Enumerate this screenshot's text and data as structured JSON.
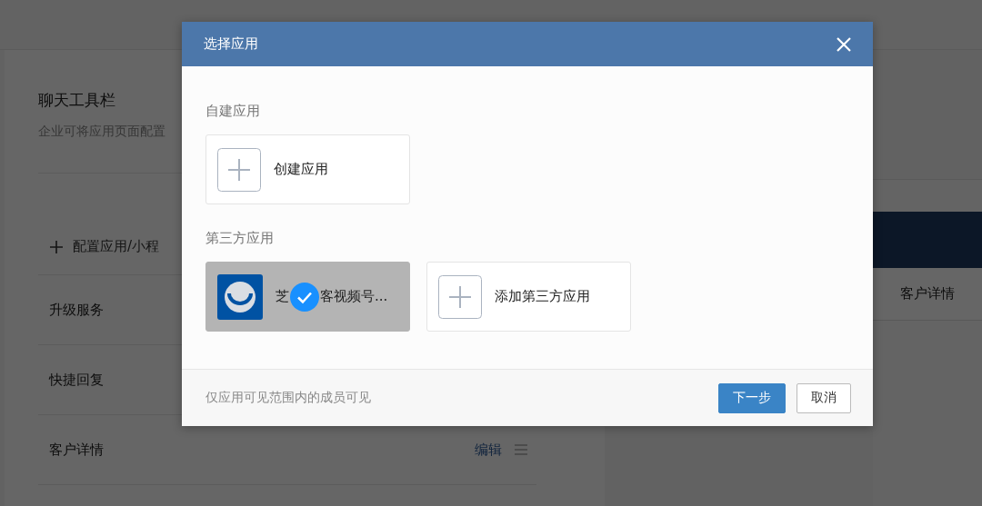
{
  "page": {
    "title": "聊天工具栏",
    "subtitle": "企业可将应用页面配置",
    "add_link": "配置应用/小程",
    "rows": [
      {
        "label": "升级服务"
      },
      {
        "label": "快捷回复"
      },
      {
        "label": "客户详情",
        "action": "编辑"
      }
    ],
    "preview": {
      "label": "客户详情"
    }
  },
  "dialog": {
    "title": "选择应用",
    "sections": [
      {
        "heading": "自建应用",
        "cards": [
          {
            "kind": "add",
            "label": "创建应用",
            "selected": false
          }
        ]
      },
      {
        "heading": "第三方应用",
        "cards": [
          {
            "kind": "app",
            "label_parts": [
              "芝",
              "客视频号..."
            ],
            "selected": true
          },
          {
            "kind": "add",
            "label": "添加第三方应用",
            "selected": false
          }
        ]
      }
    ],
    "footnote": "仅应用可见范围内的成员可见",
    "buttons": [
      {
        "label": "下一步",
        "primary": true
      },
      {
        "label": "取消",
        "primary": false
      }
    ]
  }
}
